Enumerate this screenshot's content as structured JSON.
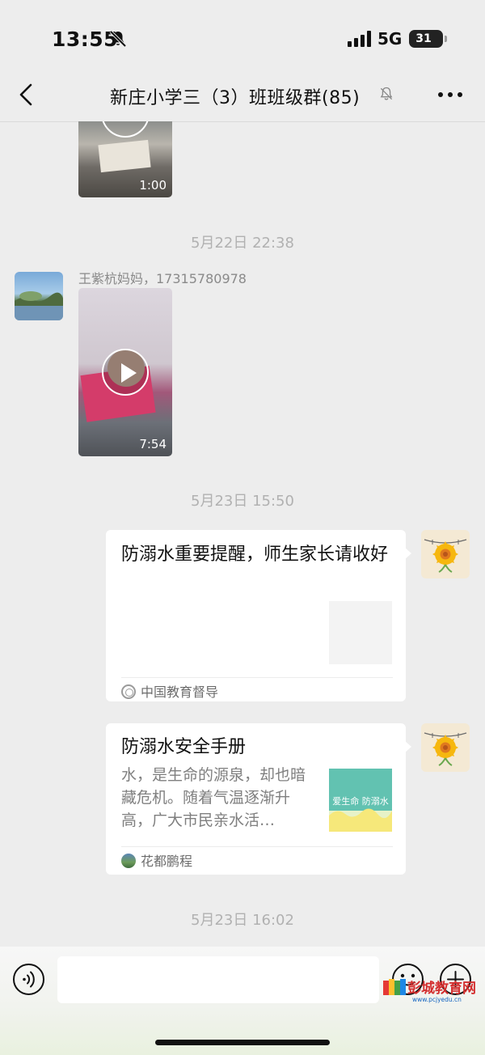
{
  "status_bar": {
    "time": "13:55",
    "network": "5G",
    "battery": "31"
  },
  "nav": {
    "title": "新庄小学三（3）班班级群(85)"
  },
  "messages": [
    {
      "type": "video",
      "duration": "1:00"
    },
    {
      "type": "timestamp",
      "text": "5月22日 22:38"
    },
    {
      "type": "video",
      "sender": "王紫杭妈妈，17315780978",
      "duration": "7:54"
    },
    {
      "type": "timestamp",
      "text": "5月23日 15:50"
    },
    {
      "type": "link_card",
      "title": "防溺水重要提醒，师生家长请收好",
      "source": "中国教育督导"
    },
    {
      "type": "link_card",
      "title": "防溺水安全手册",
      "description": "水，是生命的源泉，却也暗藏危机。随着气温逐渐升高，广大市民亲水活…",
      "source": "花都鹏程",
      "thumb_text": "爱生命 防溺水"
    },
    {
      "type": "timestamp",
      "text": "5月23日 16:02"
    }
  ],
  "input": {
    "value": ""
  },
  "watermark": {
    "text": "彭城教育网",
    "url": "www.pcjyedu.cn"
  },
  "icons": {
    "status_mute": "bell-slash-icon",
    "signal": "cellular-signal-icon",
    "battery": "battery-icon",
    "back": "chevron-left-icon",
    "title_mute": "bell-slash-icon",
    "more": "ellipsis-icon",
    "voice": "voice-icon",
    "emoji": "emoji-icon",
    "plus": "plus-icon",
    "play": "play-icon"
  },
  "colors": {
    "chat_background": "#ededed",
    "bubble": "#ffffff",
    "timestamp": "#b1b1b1"
  }
}
